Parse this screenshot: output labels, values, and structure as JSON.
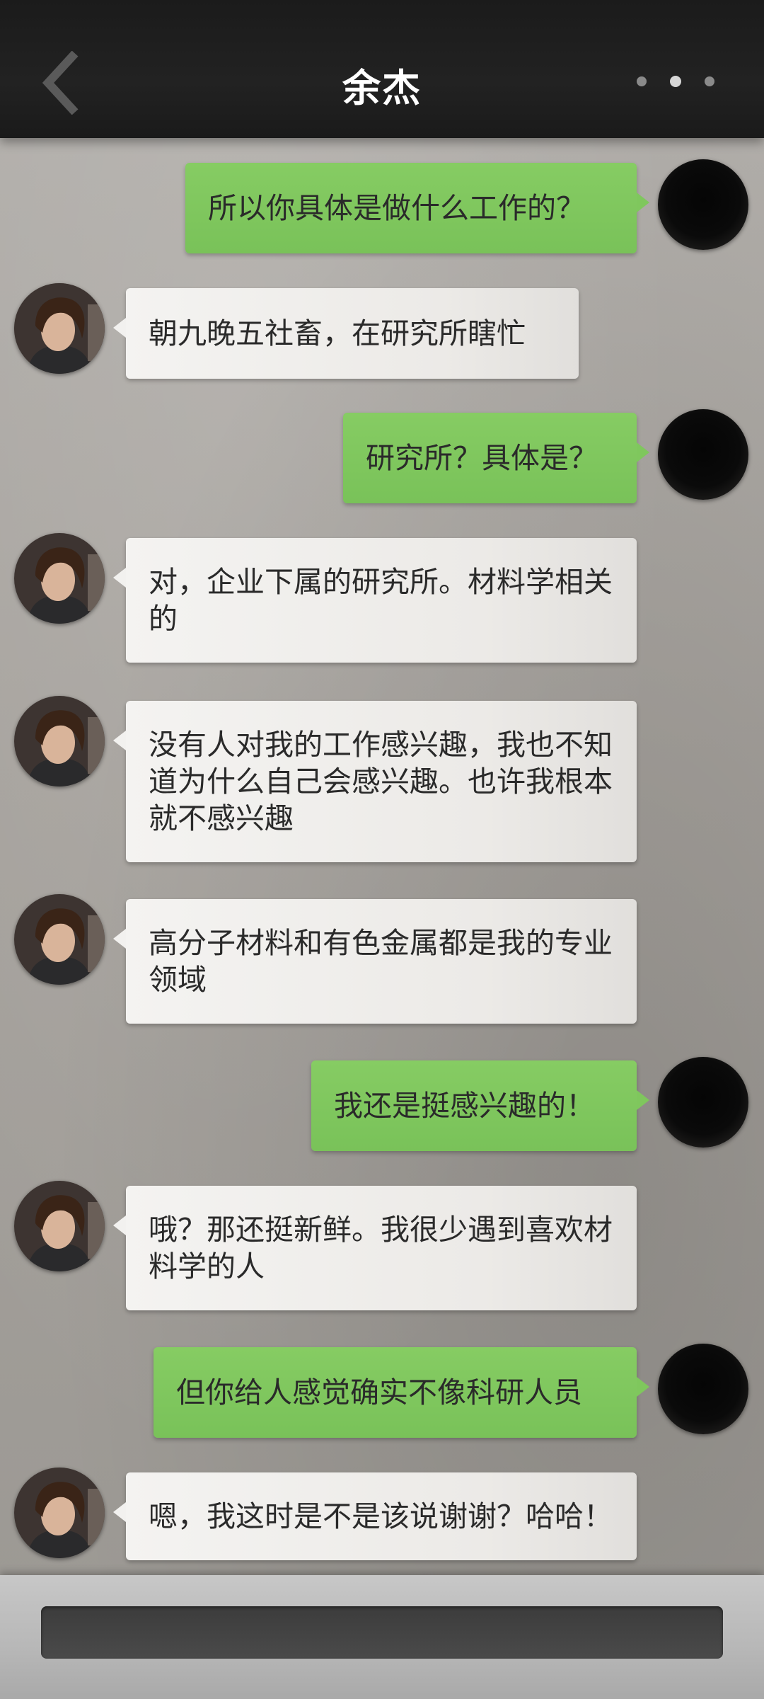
{
  "header": {
    "title": "余杰",
    "back_icon": "chevron-left-icon",
    "more_icon": "more-horizontal-icon"
  },
  "messages": [
    {
      "sender": "me",
      "text": "所以你具体是做什么工作的？"
    },
    {
      "sender": "them",
      "text": "朝九晚五社畜，在研究所瞎忙"
    },
    {
      "sender": "me",
      "text": "研究所？具体是？"
    },
    {
      "sender": "them",
      "text": "对，企业下属的研究所。材料学相关的"
    },
    {
      "sender": "them",
      "text": "没有人对我的工作感兴趣，我也不知道为什么自己会感兴趣。也许我根本就不感兴趣"
    },
    {
      "sender": "them",
      "text": "高分子材料和有色金属都是我的专业领域"
    },
    {
      "sender": "me",
      "text": "我还是挺感兴趣的！"
    },
    {
      "sender": "them",
      "text": "哦？那还挺新鲜。我很少遇到喜欢材料学的人"
    },
    {
      "sender": "me",
      "text": "但你给人感觉确实不像科研人员"
    },
    {
      "sender": "them",
      "text": "嗯，我这时是不是该说谢谢？哈哈！"
    }
  ],
  "input": {
    "placeholder": ""
  },
  "colors": {
    "header_bg": "#1f1f1f",
    "my_bubble": "#7fc75d",
    "their_bubble": "#efedea",
    "background": "#a8a5a0"
  }
}
